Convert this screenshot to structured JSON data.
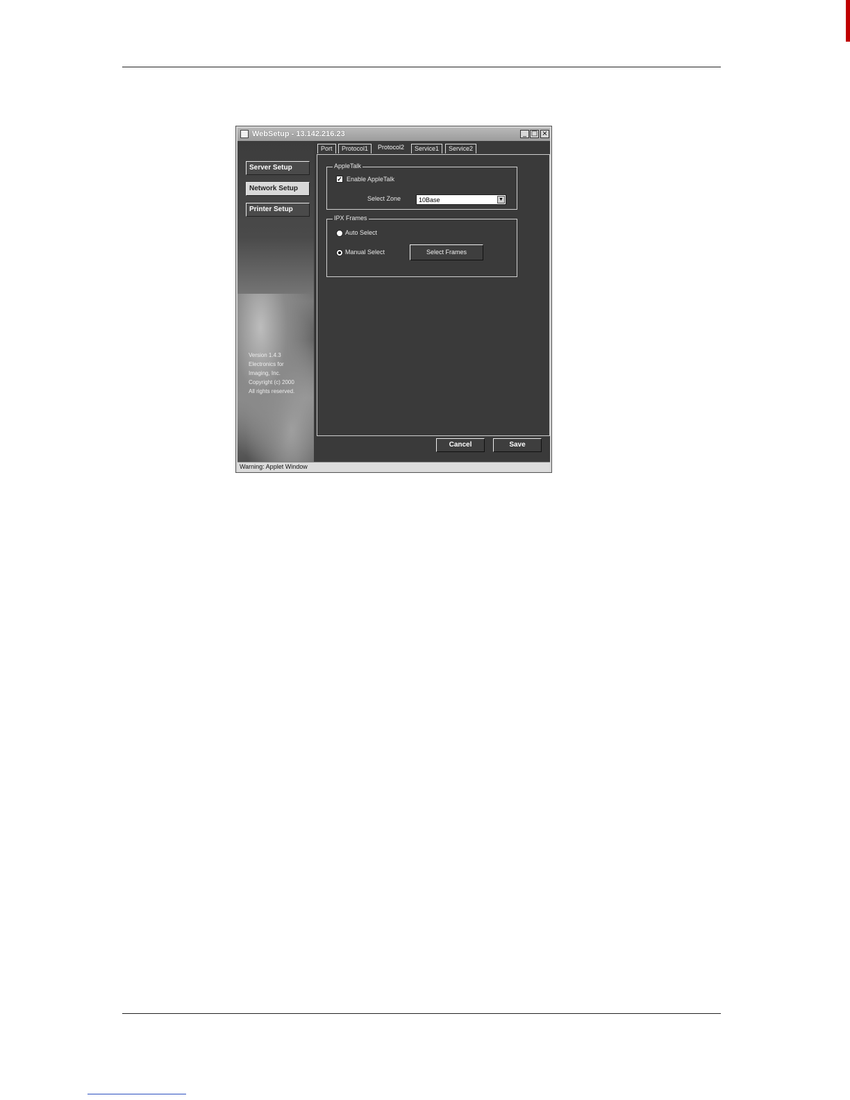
{
  "window": {
    "title": "WebSetup - 13.142.216.23",
    "controls": {
      "minimize": "_",
      "maximize": "□",
      "close": "×"
    }
  },
  "sidebar": {
    "buttons": [
      {
        "label": "Server Setup",
        "active": false
      },
      {
        "label": "Network Setup",
        "active": true
      },
      {
        "label": "Printer Setup",
        "active": false
      }
    ],
    "about_lines": [
      "Version 1.4.3",
      "Electronics for",
      "Imaging, Inc.",
      "Copyright (c) 2000",
      "All rights reserved."
    ]
  },
  "tabs": [
    {
      "label": "Port",
      "active": false
    },
    {
      "label": "Protocol1",
      "active": false
    },
    {
      "label": "Protocol2",
      "active": true
    },
    {
      "label": "Service1",
      "active": false
    },
    {
      "label": "Service2",
      "active": false
    }
  ],
  "appletalk": {
    "group_title": "AppleTalk",
    "enable_label": "Enable AppleTalk",
    "enable_checked": true,
    "zone_label": "Select Zone",
    "zone_value": "10Base"
  },
  "ipx": {
    "group_title": "IPX Frames",
    "auto_label": "Auto Select",
    "manual_label": "Manual Select",
    "selected": "manual",
    "select_frames_label": "Select Frames"
  },
  "actions": {
    "cancel_label": "Cancel",
    "save_label": "Save"
  },
  "status": {
    "text": "Warning: Applet Window"
  }
}
